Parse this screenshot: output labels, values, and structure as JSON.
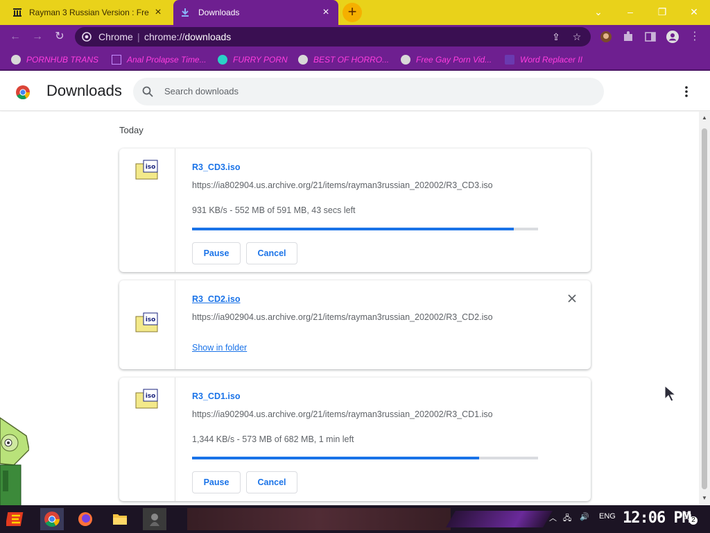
{
  "tabs": [
    {
      "title": "Rayman 3 Russian Version : Fre",
      "active": false
    },
    {
      "title": "Downloads",
      "active": true
    }
  ],
  "omnibox": {
    "site": "Chrome",
    "url_prefix": "chrome://",
    "url_host": "downloads"
  },
  "bookmarks": [
    "PORNHUB TRANS",
    "Anal Prolapse Time...",
    "FURRY PORN",
    "BEST OF HORRO...",
    "Free Gay Porn Vid...",
    "Word Replacer II"
  ],
  "header": {
    "title": "Downloads",
    "search_placeholder": "Search downloads"
  },
  "date_label": "Today",
  "downloads": [
    {
      "filename": "R3_CD3.iso",
      "url": "https://ia802904.us.archive.org/21/items/rayman3russian_202002/R3_CD3.iso",
      "status": "931 KB/s - 552 MB of 591 MB, 43 secs left",
      "progress": 0.93,
      "pause_label": "Pause",
      "cancel_label": "Cancel"
    },
    {
      "filename": "R3_CD2.iso",
      "url": "https://ia902904.us.archive.org/21/items/rayman3russian_202002/R3_CD2.iso",
      "link_label": "Show in folder",
      "complete": true
    },
    {
      "filename": "R3_CD1.iso",
      "url": "https://ia902904.us.archive.org/21/items/rayman3russian_202002/R3_CD1.iso",
      "status": "1,344 KB/s - 573 MB of 682 MB, 1 min left",
      "progress": 0.83,
      "pause_label": "Pause",
      "cancel_label": "Cancel"
    }
  ],
  "taskbar": {
    "language": "ENG",
    "clock": "12:06 PM",
    "notification_count": "2"
  },
  "colors": {
    "accent": "#1a73e8",
    "toolbar": "#6e1f90",
    "tabstrip": "#e9d21a"
  }
}
